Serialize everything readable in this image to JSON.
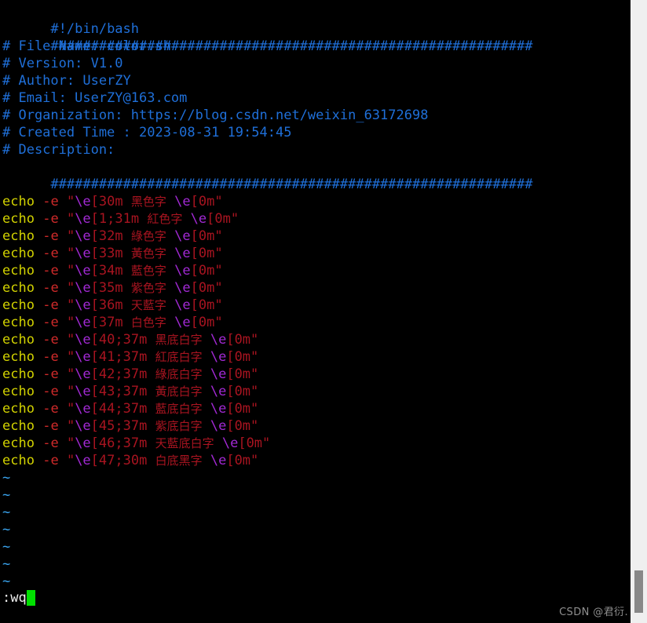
{
  "editor": {
    "name": "vim",
    "background_color": "#000000",
    "comment_color": "#1f6fd8",
    "command_color": "#d2d200",
    "flag_color": "#d02a2a",
    "string_color": "#a81420",
    "escape_color": "#a229d4",
    "tilde_color": "#3aa5f0",
    "cursor_color": "#00e000"
  },
  "header": {
    "shebang": "#!/bin/bash",
    "rule_top": "############################################################",
    "rule_bottom": "############################################################",
    "lines": [
      "# File Name: color.sh",
      "# Version: V1.0",
      "# Author: UserZY",
      "# Email: UserZY@163.com",
      "# Organization: https://blog.csdn.net/weixin_63172698",
      "# Created Time : 2023-08-31 19:54:45",
      "# Description:"
    ]
  },
  "code": {
    "command": "echo",
    "flag": "-e",
    "quote": "\"",
    "escape": "\\e",
    "reset_seq": "[0m",
    "statements": [
      {
        "seq": "[30m",
        "text": "黑色字"
      },
      {
        "seq": "[1;31m",
        "text": "紅色字"
      },
      {
        "seq": "[32m",
        "text": "綠色字"
      },
      {
        "seq": "[33m",
        "text": "黃色字"
      },
      {
        "seq": "[34m",
        "text": "藍色字"
      },
      {
        "seq": "[35m",
        "text": "紫色字"
      },
      {
        "seq": "[36m",
        "text": "天藍字"
      },
      {
        "seq": "[37m",
        "text": "白色字"
      },
      {
        "seq": "[40;37m",
        "text": "黑底白字"
      },
      {
        "seq": "[41;37m",
        "text": "紅底白字"
      },
      {
        "seq": "[42;37m",
        "text": "綠底白字"
      },
      {
        "seq": "[43;37m",
        "text": "黃底白字"
      },
      {
        "seq": "[44;37m",
        "text": "藍底白字"
      },
      {
        "seq": "[45;37m",
        "text": "紫底白字"
      },
      {
        "seq": "[46;37m",
        "text": "天藍底白字"
      },
      {
        "seq": "[47;30m",
        "text": "白底黑字"
      }
    ]
  },
  "filler": {
    "marker": "~",
    "count": 7
  },
  "command_line": {
    "text": ":wq",
    "cursor": "block-cursor"
  },
  "watermark": {
    "text": "CSDN @君衍."
  },
  "scrollbar": {
    "track_color": "#efefef",
    "thumb_color": "#888888"
  }
}
